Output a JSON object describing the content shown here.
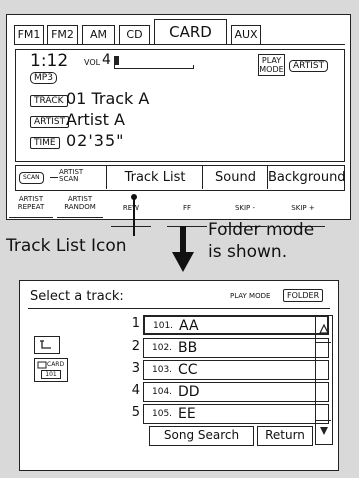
{
  "top_screen": {
    "tabs": [
      "FM1",
      "FM2",
      "AM",
      "CD",
      "CARD",
      "AUX"
    ],
    "active_tab": "CARD",
    "track_number_display": "1:12",
    "volume_label": "VOL",
    "volume_value": "4",
    "format_badge": "MP3",
    "play_mode_label": "PLAY\nMODE",
    "artist_badge": "ARTIST",
    "track_label": "TRACK",
    "track_value": "01  Track  A",
    "artist_label": "ARTIST",
    "artist_value": "Artist  A",
    "time_label": "TIME",
    "time_value": "02'35\"",
    "scan_badge": "SCAN",
    "artist_scan_label": "ARTIST\nSCAN",
    "mid_buttons": [
      "Track  List",
      "Sound",
      "Background"
    ],
    "bottom_buttons": [
      "ARTIST\nREPEAT",
      "ARTIST\nRANDOM",
      "REW",
      "FF",
      "SKIP -",
      "SKIP +"
    ]
  },
  "captions": {
    "track_list_icon": "Track List Icon",
    "folder_mode_line1": "Folder mode",
    "folder_mode_line2": "is shown."
  },
  "bottom_panel": {
    "title": "Select a track:",
    "play_mode_label": "PLAY MODE",
    "folder_badge": "FOLDER",
    "card_label": "CARD",
    "folder_number": "101",
    "tracks": [
      {
        "num": "1",
        "code": "101.",
        "name": "AA"
      },
      {
        "num": "2",
        "code": "102.",
        "name": "BB"
      },
      {
        "num": "3",
        "code": "103.",
        "name": "CC"
      },
      {
        "num": "4",
        "code": "104.",
        "name": "DD"
      },
      {
        "num": "5",
        "code": "105.",
        "name": "EE"
      }
    ],
    "song_search_label": "Song Search",
    "return_label": "Return"
  }
}
